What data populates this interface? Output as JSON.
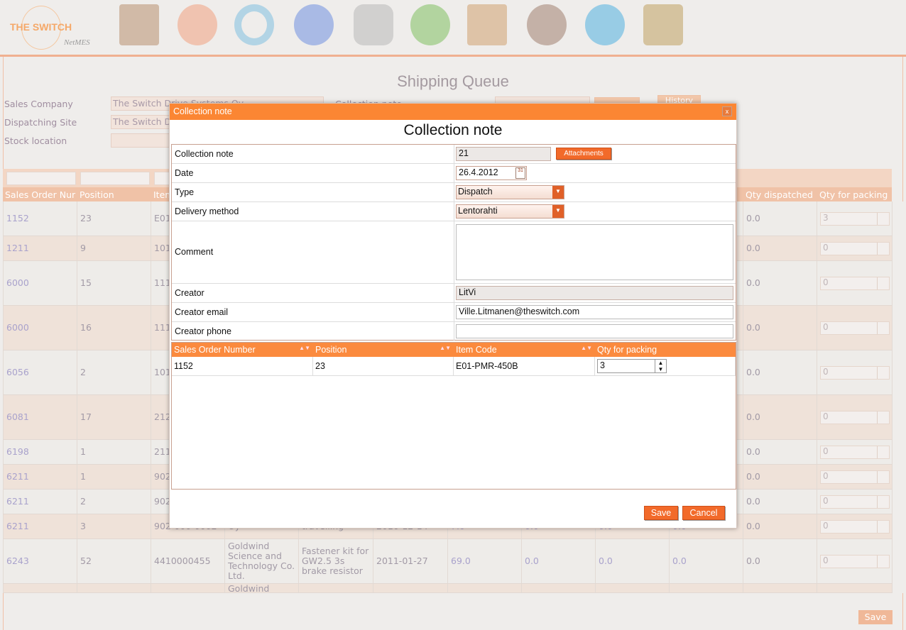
{
  "brand": {
    "name": "THE SWITCH",
    "product": "NetMES"
  },
  "nav_icons": [
    "home-icon",
    "pinwheel-icon",
    "cycle-icon",
    "globe-icon",
    "database-icon",
    "add-icon",
    "chart-icon",
    "users-icon",
    "info-icon",
    "lock-icon"
  ],
  "page": {
    "title": "Shipping Queue",
    "filters": {
      "sales_company_label": "Sales Company",
      "sales_company_value": "The Switch Drive Systems Oy",
      "dispatching_site_label": "Dispatching Site",
      "dispatching_site_value": "The Switch D",
      "stock_location_label": "Stock location",
      "collection_note_label": "Collection note",
      "history_label": "History"
    },
    "columns": [
      "Sales Order Nur",
      "Position",
      "Item",
      "Qty dispatched",
      "Qty for packing"
    ],
    "rows": [
      {
        "so": "1152",
        "pos": "23",
        "item": "E01",
        "qd": "0.0",
        "qp": "3"
      },
      {
        "so": "1211",
        "pos": "9",
        "item": "101",
        "qd": "0.0",
        "qp": "0"
      },
      {
        "so": "6000",
        "pos": "15",
        "item": "111",
        "qd": "0.0",
        "qp": "0"
      },
      {
        "so": "6000",
        "pos": "16",
        "item": "111",
        "qd": "0.0",
        "qp": "0"
      },
      {
        "so": "6056",
        "pos": "2",
        "item": "101",
        "qd": "0.0",
        "qp": "0"
      },
      {
        "so": "6081",
        "pos": "17",
        "item": "212",
        "qd": "0.0",
        "qp": "0"
      },
      {
        "so": "6198",
        "pos": "1",
        "item": "211",
        "qd": "0.0",
        "qp": "0"
      },
      {
        "so": "6211",
        "pos": "1",
        "item": "902",
        "qd": "0.0",
        "qp": "0"
      },
      {
        "so": "6211",
        "pos": "2",
        "item": "902",
        "qd": "0.0",
        "qp": "0"
      },
      {
        "so": "6211",
        "pos": "3",
        "item": "902-000-0002",
        "customer": "Oy",
        "desc": "travelling",
        "date": "2010-12-14",
        "q1": "7.0",
        "q2": "0.0",
        "q3": "0.0",
        "q4": "0.0",
        "qd": "0.0",
        "qp": "0"
      },
      {
        "so": "6243",
        "pos": "52",
        "item": "4410000455",
        "customer": "Goldwind Science and Technology Co. Ltd.",
        "desc": "Fastener kit for GW2.5 3s brake resistor",
        "date": "2011-01-27",
        "q1": "69.0",
        "q2": "0.0",
        "q3": "0.0",
        "q4": "0.0",
        "qd": "0.0",
        "qp": "0"
      },
      {
        "so": "",
        "pos": "",
        "item": "",
        "customer": "Goldwind",
        "qd": "",
        "qp": ""
      }
    ],
    "save_label": "Save"
  },
  "modal": {
    "title": "Collection note",
    "close": "x",
    "heading": "Collection note",
    "fields": {
      "collection_note_label": "Collection note",
      "collection_note_value": "21",
      "attachments": "Attachments",
      "date_label": "Date",
      "date_value": "26.4.2012",
      "type_label": "Type",
      "type_value": "Dispatch",
      "delivery_label": "Delivery method",
      "delivery_value": "Lentorahti",
      "comment_label": "Comment",
      "comment_value": "",
      "creator_label": "Creator",
      "creator_value": "LitVi",
      "email_label": "Creator email",
      "email_value": "Ville.Litmanen@theswitch.com",
      "phone_label": "Creator phone",
      "phone_value": ""
    },
    "lines": {
      "columns": [
        "Sales Order Number",
        "Position",
        "Item Code",
        "Qty for packing"
      ],
      "rows": [
        {
          "so": "1152",
          "pos": "23",
          "item": "E01-PMR-450B",
          "qty": "3"
        }
      ]
    },
    "save": "Save",
    "cancel": "Cancel"
  },
  "colors": {
    "accent": "#fb8633",
    "button": "#f26a2a"
  }
}
